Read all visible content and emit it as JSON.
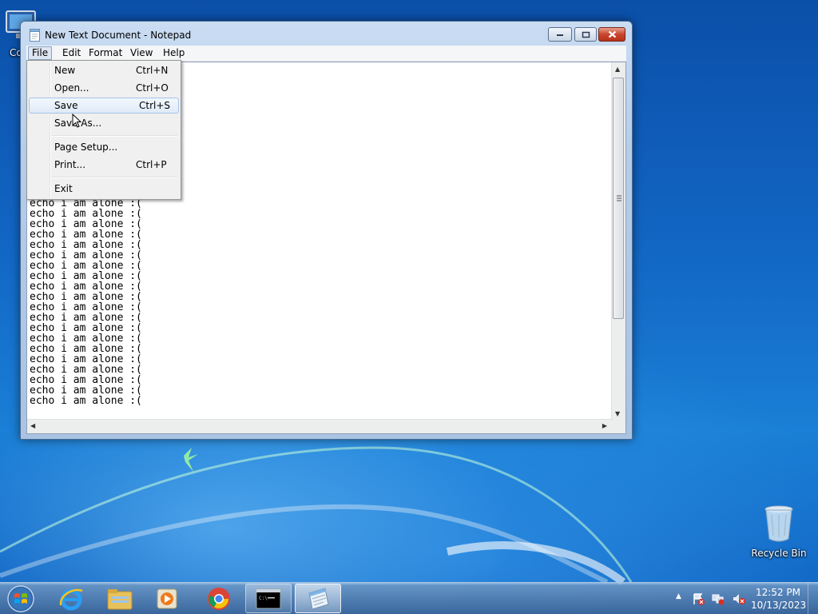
{
  "window": {
    "title": "New Text Document - Notepad"
  },
  "menu_bar": {
    "items": [
      "File",
      "Edit",
      "Format",
      "View",
      "Help"
    ]
  },
  "file_menu": {
    "new": {
      "label": "New",
      "shortcut": "Ctrl+N"
    },
    "open": {
      "label": "Open...",
      "shortcut": "Ctrl+O"
    },
    "save": {
      "label": "Save",
      "shortcut": "Ctrl+S"
    },
    "save_as": {
      "label": "Save As..."
    },
    "page_setup": {
      "label": "Page Setup..."
    },
    "print": {
      "label": "Print...",
      "shortcut": "Ctrl+P"
    },
    "exit": {
      "label": "Exit"
    }
  },
  "document": {
    "lines": [
      "echo i am alone :(",
      "echo i am alone :(",
      "echo i am alone :(",
      "echo i am alone :(",
      "echo i am alone :(",
      "echo i am alone :(",
      "echo i am alone :(",
      "echo i am alone :(",
      "echo i am alone :(",
      "echo i am alone :(",
      "echo i am alone :(",
      "echo i am alone :(",
      "echo i am alone :(",
      "echo i am alone :(",
      "echo i am alone :(",
      "echo i am alone :(",
      "echo i am alone :(",
      "echo i am alone :(",
      "echo i am alone :(",
      "echo i am alone :("
    ]
  },
  "desktop": {
    "computer_label": "Co",
    "recycle_bin_label": "Recycle Bin"
  },
  "taskbar": {
    "time": "12:52 PM",
    "date": "10/13/2023",
    "pinned": [
      "start-orb",
      "internet-explorer-icon",
      "file-explorer-icon",
      "media-player-icon",
      "chrome-icon",
      "command-prompt-icon",
      "notepad-icon"
    ]
  }
}
